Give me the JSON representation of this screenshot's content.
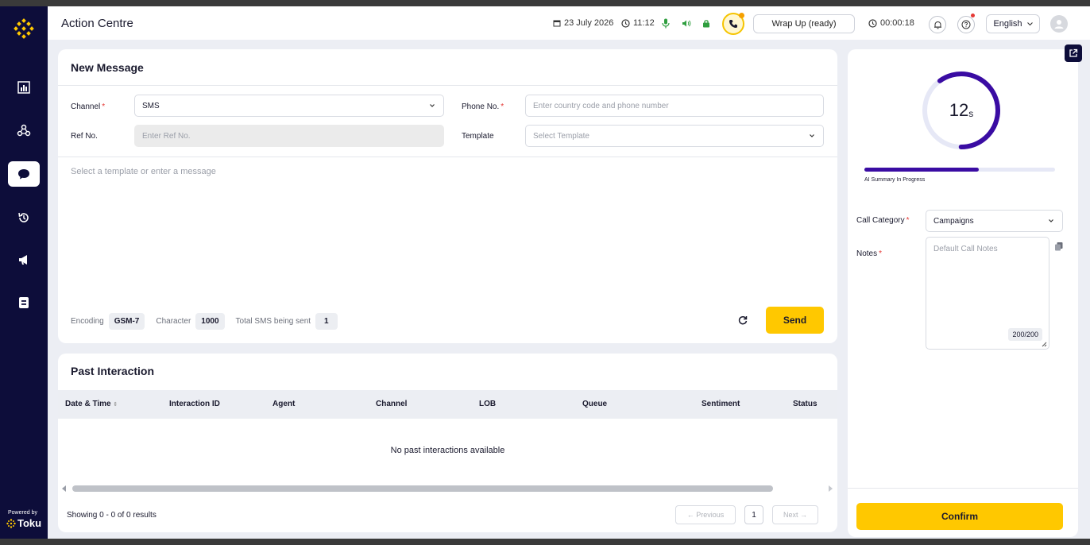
{
  "app": {
    "title": "Action Centre",
    "brand_powered": "Powered by",
    "brand_name": "Toku"
  },
  "sidebar": {
    "items": [
      {
        "name": "dashboard",
        "icon": "bar-chart-icon",
        "active": false
      },
      {
        "name": "network",
        "icon": "network-icon",
        "active": false
      },
      {
        "name": "messages",
        "icon": "chat-bubble-icon",
        "active": true
      },
      {
        "name": "history",
        "icon": "history-icon",
        "active": false
      },
      {
        "name": "campaigns",
        "icon": "megaphone-icon",
        "active": false
      },
      {
        "name": "contacts",
        "icon": "contact-book-icon",
        "active": false
      }
    ]
  },
  "topbar": {
    "date": "23 July 2026",
    "time": "11:12",
    "wrap_up": "Wrap Up (ready)",
    "timer": "00:00:18",
    "language": "English"
  },
  "new_message": {
    "title": "New Message",
    "channel_label": "Channel",
    "channel_value": "SMS",
    "phone_label": "Phone No.",
    "phone_placeholder": "Enter country code and phone number",
    "ref_label": "Ref No.",
    "ref_placeholder": "Enter Ref No.",
    "template_label": "Template",
    "template_placeholder": "Select Template",
    "message_placeholder": "Select a template or enter a message",
    "encoding_label": "Encoding",
    "encoding_value": "GSM-7",
    "character_label": "Character",
    "character_value": "1000",
    "total_sms_label": "Total SMS being sent",
    "total_sms_value": "1",
    "send_label": "Send"
  },
  "past_interaction": {
    "title": "Past Interaction",
    "columns": [
      "Date & Time",
      "Interaction ID",
      "Agent",
      "Channel",
      "LOB",
      "Queue",
      "Sentiment",
      "Status"
    ],
    "empty_text": "No past interactions available",
    "showing": "Showing 0 - 0 of 0 results",
    "prev_label": "← Previous",
    "page": "1",
    "next_label": "Next →"
  },
  "right_panel": {
    "timer_value": "12",
    "timer_unit": "s",
    "timer_fraction": 0.6,
    "ai_summary_label": "AI Summary In Progress",
    "ai_summary_progress": 0.6,
    "call_category_label": "Call Category",
    "call_category_value": "Campaigns",
    "notes_label": "Notes",
    "notes_placeholder": "Default Call Notes",
    "notes_count": "200/200",
    "confirm_label": "Confirm"
  },
  "colors": {
    "sidebar": "#0d0d3a",
    "accent": "#ffc800",
    "progress": "#3a0ca3",
    "required": "#e53935",
    "mic_green": "#2e9e3e"
  }
}
